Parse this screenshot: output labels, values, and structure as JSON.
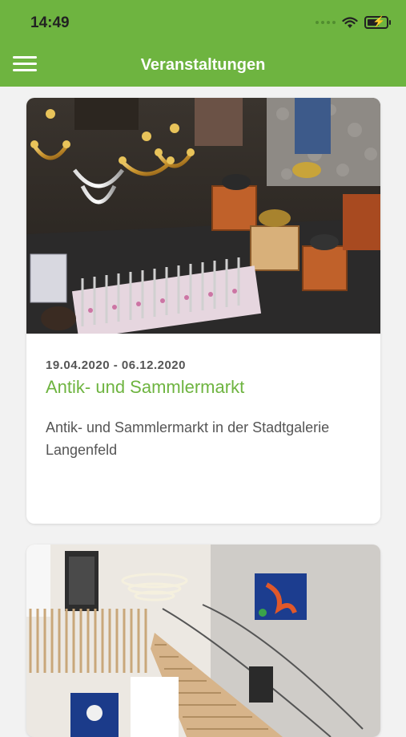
{
  "status_bar": {
    "time": "14:49",
    "battery_charge": 0.8,
    "icons": [
      "cellular-dots-icon",
      "wifi-icon",
      "battery-charging-icon"
    ]
  },
  "header": {
    "title": "Veranstaltungen",
    "menu_icon": "hamburger-menu-icon",
    "background_color": "#6eb440"
  },
  "events": [
    {
      "date_range": "19.04.2020 - 06.12.2020",
      "title": "Antik- und Sammlermarkt",
      "description": "Antik- und Sammlermarkt in der Stadtgalerie Langenfeld",
      "image": "flea-market-photo"
    },
    {
      "image": "stairwell-gallery-photo"
    }
  ],
  "accent_color": "#6eb440"
}
